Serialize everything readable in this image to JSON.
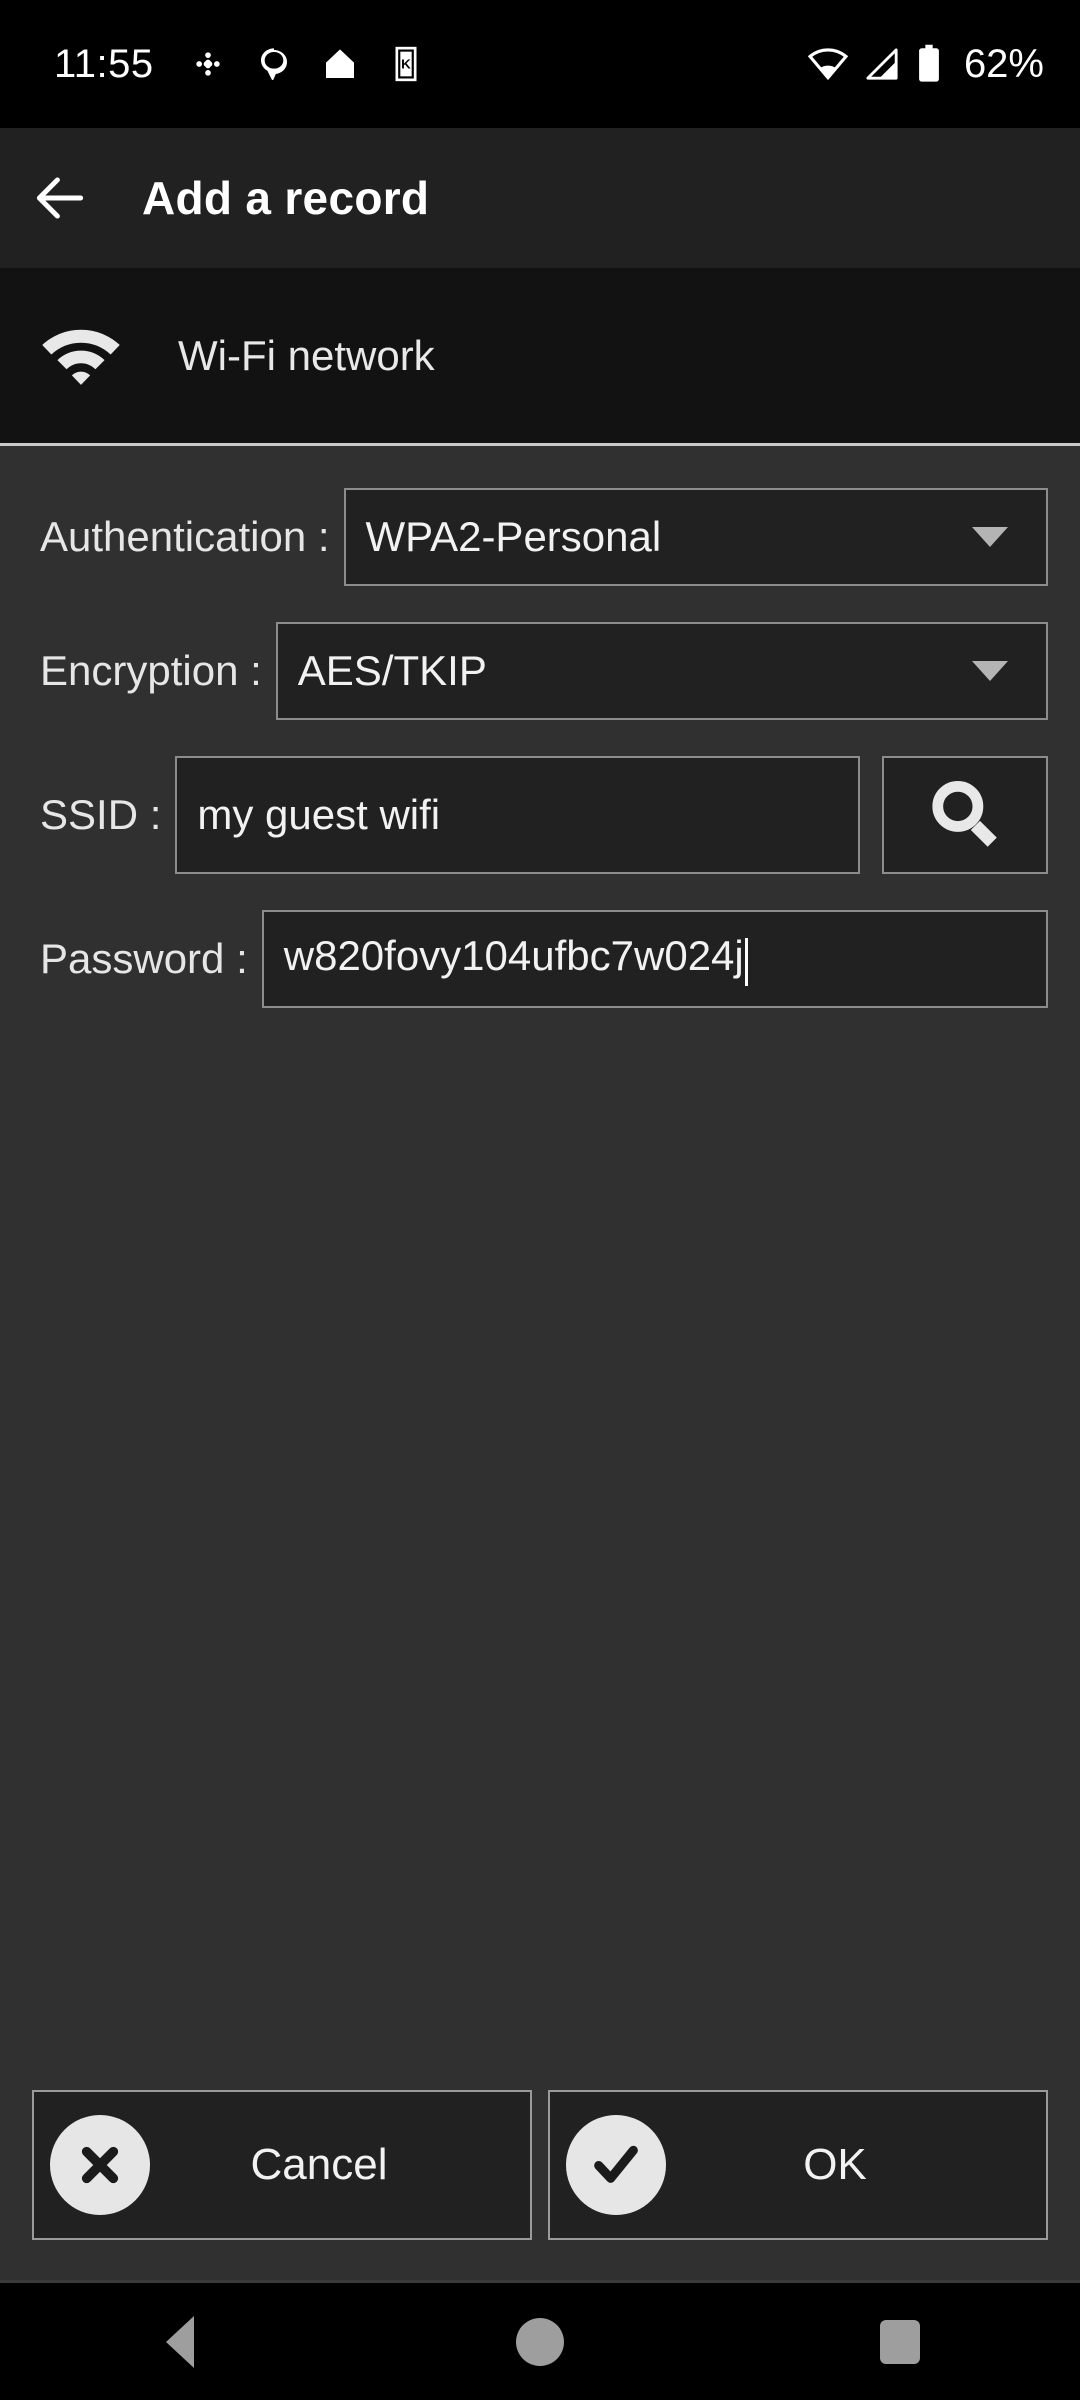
{
  "status_bar": {
    "time": "11:55",
    "battery_percent": "62%",
    "left_icons": [
      "slack-icon",
      "speech-bubble-icon",
      "home-icon",
      "card-k-icon"
    ],
    "right_icons": [
      "wifi-icon",
      "cell-signal-icon",
      "battery-icon"
    ]
  },
  "title_bar": {
    "back_icon": "arrow-left-icon",
    "title": "Add a record"
  },
  "section": {
    "icon": "wifi-icon",
    "label": "Wi-Fi network"
  },
  "form": {
    "authentication": {
      "label": "Authentication :",
      "value": "WPA2-Personal",
      "dropdown_icon": "chevron-down-icon"
    },
    "encryption": {
      "label": "Encryption :",
      "value": "AES/TKIP",
      "dropdown_icon": "chevron-down-icon"
    },
    "ssid": {
      "label": "SSID :",
      "value": "my guest wifi",
      "placeholder": "",
      "search_icon": "search-icon"
    },
    "password": {
      "label": "Password :",
      "value": "w820fovy104ufbc7w024j",
      "placeholder": ""
    }
  },
  "buttons": {
    "cancel": {
      "label": "Cancel",
      "icon": "close-circle-icon"
    },
    "ok": {
      "label": "OK",
      "icon": "check-circle-icon"
    }
  },
  "nav_bar": {
    "back": "nav-back-icon",
    "home": "nav-home-icon",
    "recents": "nav-recents-icon"
  },
  "colors": {
    "page_background": "#303030",
    "title_bar": "#212121",
    "section_header": "#121212",
    "field_background": "#212121",
    "field_border": "#8c8c8c",
    "text": "#f2f2f2",
    "status_bar": "#000000"
  }
}
